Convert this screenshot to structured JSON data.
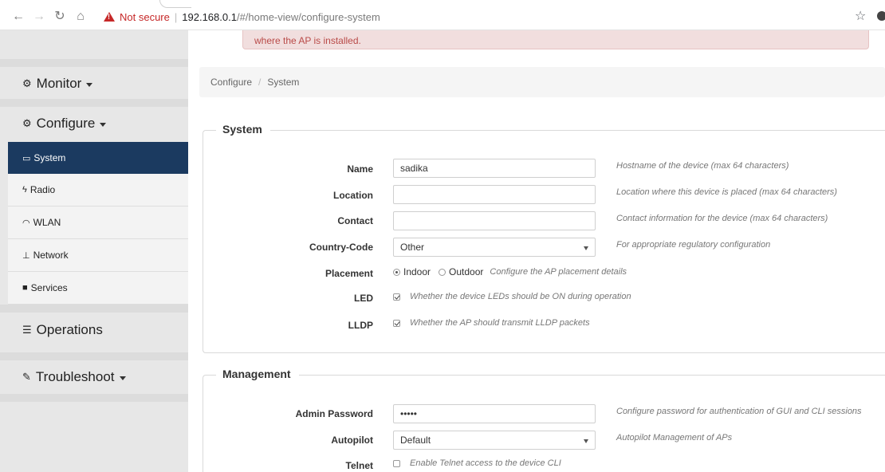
{
  "browser": {
    "not_secure": "Not secure",
    "url_host": "192.168.0.1",
    "url_path": "/#/home-view/configure-system"
  },
  "sidebar": {
    "monitor": "Monitor",
    "configure": "Configure",
    "operations": "Operations",
    "troubleshoot": "Troubleshoot",
    "sub_items": [
      {
        "label": "System",
        "icon": "monitor-icon"
      },
      {
        "label": "Radio",
        "icon": "bolt-icon"
      },
      {
        "label": "WLAN",
        "icon": "wifi-icon"
      },
      {
        "label": "Network",
        "icon": "sitemap-icon"
      },
      {
        "label": "Services",
        "icon": "briefcase-icon"
      }
    ],
    "active_color": "#1b3a60"
  },
  "alert": {
    "text": "where the AP is installed."
  },
  "breadcrumb": {
    "items": [
      "Configure",
      "System"
    ]
  },
  "system": {
    "legend": "System",
    "name": {
      "label": "Name",
      "value": "sadika",
      "help": "Hostname of the device (max 64 characters)"
    },
    "location": {
      "label": "Location",
      "value": "",
      "help": "Location where this device is placed (max 64 characters)"
    },
    "contact": {
      "label": "Contact",
      "value": "",
      "help": "Contact information for the device (max 64 characters)"
    },
    "country": {
      "label": "Country-Code",
      "value": "Other",
      "help": "For appropriate regulatory configuration"
    },
    "placement": {
      "label": "Placement",
      "indoor": "Indoor",
      "outdoor": "Outdoor",
      "help": "Configure the AP placement details"
    },
    "led": {
      "label": "LED",
      "help": "Whether the device LEDs should be ON during operation"
    },
    "lldp": {
      "label": "LLDP",
      "help": "Whether the AP should transmit LLDP packets"
    }
  },
  "management": {
    "legend": "Management",
    "admin_password": {
      "label": "Admin Password",
      "value": "•••••",
      "help": "Configure password for authentication of GUI and CLI sessions"
    },
    "autopilot": {
      "label": "Autopilot",
      "value": "Default",
      "help": "Autopilot Management of APs"
    },
    "telnet": {
      "label": "Telnet",
      "help": "Enable Telnet access to the device CLI"
    }
  }
}
